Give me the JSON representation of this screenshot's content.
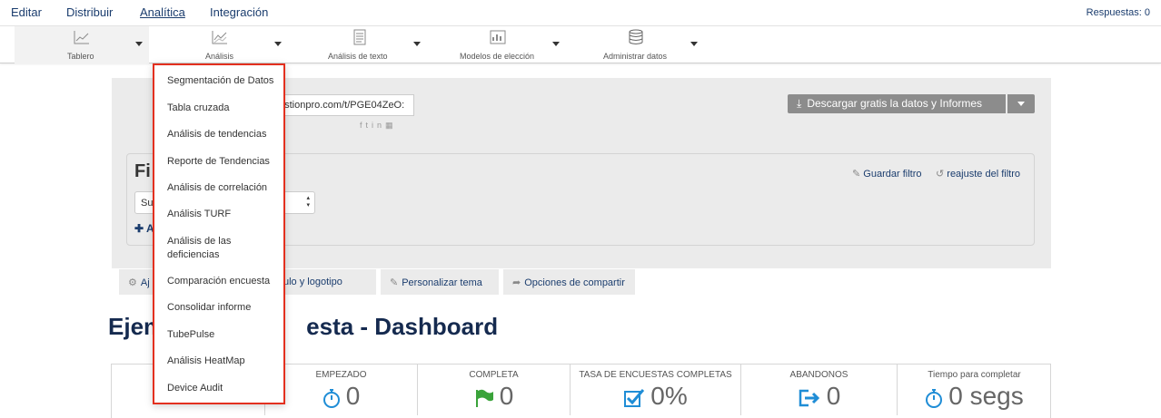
{
  "topnav": {
    "items": [
      "Editar",
      "Distribuir",
      "Analítica",
      "Integración"
    ],
    "active": "Analítica",
    "responses": "Respuestas: 0"
  },
  "toolbar": {
    "groups": [
      {
        "label": "Tablero",
        "icon": "line-chart-icon"
      },
      {
        "label": "Análisis",
        "icon": "analysis-chart-icon"
      },
      {
        "label": "Análisis de texto",
        "icon": "text-document-icon"
      },
      {
        "label": "Modelos de elección",
        "icon": "choice-chart-icon"
      },
      {
        "label": "Administrar datos",
        "icon": "database-icon"
      }
    ]
  },
  "share": {
    "url": "estionpro.com/t/PGE04ZeO:",
    "social_icons": [
      "facebook-icon",
      "twitter-icon",
      "linkedin-icon",
      "qr-icon"
    ]
  },
  "download": {
    "label": "Descargar gratis la datos y Informes"
  },
  "filter": {
    "title": "Fi",
    "select_value": "Su",
    "add_label": "A",
    "save_label": "Guardar filtro",
    "reset_label": "reajuste del filtro"
  },
  "tabs": [
    {
      "label": "Aj",
      "icon": "gears-icon"
    },
    {
      "label": "ulo y logotipo",
      "icon": ""
    },
    {
      "label": "Personalizar tema",
      "icon": "edit-icon"
    },
    {
      "label": "Opciones de compartir",
      "icon": "share-icon"
    }
  ],
  "page_title": {
    "left": "Ejem",
    "right": "esta - Dashboard"
  },
  "stats": [
    {
      "label": "",
      "value": ""
    },
    {
      "label": "EMPEZADO",
      "value": "0",
      "icon": "stopwatch-icon"
    },
    {
      "label": "COMPLETA",
      "value": "0",
      "icon": "flag-icon"
    },
    {
      "label": "TASA DE ENCUESTAS COMPLETAS",
      "value": "0%",
      "icon": "checkbox-icon"
    },
    {
      "label": "ABANDONOS",
      "value": "0",
      "icon": "exit-icon"
    },
    {
      "label": "Tiempo para completar",
      "value": "0 segs",
      "icon": "stopwatch-icon"
    }
  ],
  "dropdown": {
    "items": [
      "Segmentación de Datos",
      "Tabla cruzada",
      "Análisis de tendencias",
      "Reporte de Tendencias",
      "Análisis de correlación",
      "Análisis TURF",
      "Análisis de las deficiencias",
      "Comparación encuesta",
      "Consolidar informe",
      "TubePulse",
      "Análisis HeatMap",
      "Device Audit"
    ]
  },
  "colors": {
    "nav_text": "#1b3d6e",
    "highlight_border": "#e3301f",
    "icon_blue": "#1f8dd6",
    "icon_green": "#3aa33a"
  }
}
